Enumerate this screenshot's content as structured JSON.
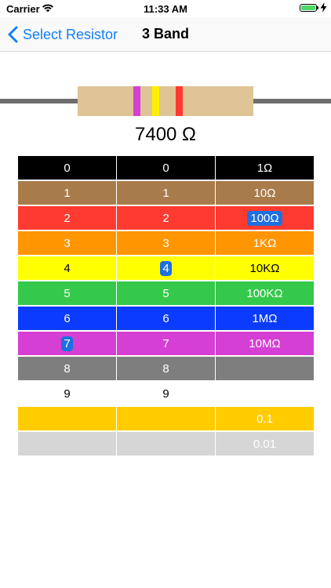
{
  "status_bar": {
    "carrier": "Carrier",
    "time": "11:33 AM"
  },
  "nav": {
    "back_label": "Select Resistor",
    "title": "3 Band"
  },
  "resistor": {
    "body_color": "#dfc595",
    "bands": [
      {
        "color": "#d53fd3"
      },
      {
        "color": "#ffef00"
      },
      {
        "color": "#ff3a30"
      }
    ]
  },
  "resistance_text": "7400 Ω",
  "selection": {
    "band1": "7",
    "band2": "4",
    "multiplier": "100Ω"
  },
  "rows": [
    {
      "bg": "#000000",
      "fg": "#ffffff",
      "c1": "0",
      "c2": "0",
      "c3": "1Ω"
    },
    {
      "bg": "#a87b4a",
      "fg": "#ffffff",
      "c1": "1",
      "c2": "1",
      "c3": "10Ω"
    },
    {
      "bg": "#ff3a30",
      "fg": "#ffffff",
      "c1": "2",
      "c2": "2",
      "c3": "100Ω",
      "sel3": true
    },
    {
      "bg": "#ff9500",
      "fg": "#ffffff",
      "c1": "3",
      "c2": "3",
      "c3": "1KΩ"
    },
    {
      "bg": "#ffff00",
      "fg": "#000000",
      "c1": "4",
      "c2": "4",
      "c3": "10KΩ",
      "sel2": true
    },
    {
      "bg": "#34c94a",
      "fg": "#ffffff",
      "c1": "5",
      "c2": "5",
      "c3": "100KΩ"
    },
    {
      "bg": "#0a3bff",
      "fg": "#ffffff",
      "c1": "6",
      "c2": "6",
      "c3": "1MΩ"
    },
    {
      "bg": "#d53fd3",
      "fg": "#ffffff",
      "c1": "7",
      "c2": "7",
      "c3": "10MΩ",
      "sel1": true
    },
    {
      "bg": "#7e7e7e",
      "fg": "#ffffff",
      "c1": "8",
      "c2": "8",
      "c3": ""
    },
    {
      "bg": "#ffffff",
      "fg": "#000000",
      "c1": "9",
      "c2": "9",
      "c3": "",
      "c3bg": "#ffffff"
    },
    {
      "bg": "#ffcc00",
      "fg": "#ffffff",
      "c1": "",
      "c2": "",
      "c3": "0.1"
    },
    {
      "bg": "#d6d6d6",
      "fg": "#ffffff",
      "c1": "",
      "c2": "",
      "c3": "0.01"
    }
  ]
}
